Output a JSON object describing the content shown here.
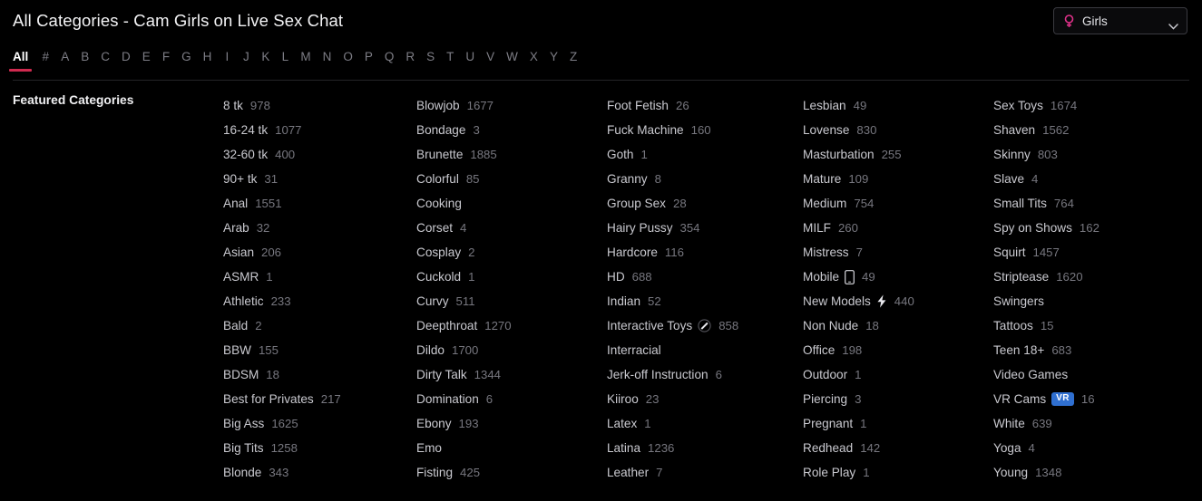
{
  "header": {
    "title": "All Categories - Cam Girls on Live Sex Chat",
    "gender_select": {
      "icon": "venus-icon",
      "value": "Girls",
      "chevron": "chevron-down-icon"
    }
  },
  "alphabet_filter": {
    "active": "All",
    "items": [
      "All",
      "#",
      "A",
      "B",
      "C",
      "D",
      "E",
      "F",
      "G",
      "H",
      "I",
      "J",
      "K",
      "L",
      "M",
      "N",
      "O",
      "P",
      "Q",
      "R",
      "S",
      "T",
      "U",
      "V",
      "W",
      "X",
      "Y",
      "Z"
    ]
  },
  "sidebar": {
    "featured_title": "Featured Categories"
  },
  "colors": {
    "accent": "#d02a4f",
    "venus": "#e0318a",
    "vr_badge": "#2f6fd0",
    "background": "#000000",
    "text_primary": "#c9c9cf",
    "text_muted": "#77777f"
  },
  "categories": {
    "columns": [
      [
        {
          "name": "8 tk",
          "count": "978"
        },
        {
          "name": "16-24 tk",
          "count": "1077"
        },
        {
          "name": "32-60 tk",
          "count": "400"
        },
        {
          "name": "90+ tk",
          "count": "31"
        },
        {
          "name": "Anal",
          "count": "1551"
        },
        {
          "name": "Arab",
          "count": "32"
        },
        {
          "name": "Asian",
          "count": "206"
        },
        {
          "name": "ASMR",
          "count": "1"
        },
        {
          "name": "Athletic",
          "count": "233"
        },
        {
          "name": "Bald",
          "count": "2"
        },
        {
          "name": "BBW",
          "count": "155"
        },
        {
          "name": "BDSM",
          "count": "18"
        },
        {
          "name": "Best for Privates",
          "count": "217"
        },
        {
          "name": "Big Ass",
          "count": "1625"
        },
        {
          "name": "Big Tits",
          "count": "1258"
        },
        {
          "name": "Blonde",
          "count": "343"
        }
      ],
      [
        {
          "name": "Blowjob",
          "count": "1677"
        },
        {
          "name": "Bondage",
          "count": "3"
        },
        {
          "name": "Brunette",
          "count": "1885"
        },
        {
          "name": "Colorful",
          "count": "85"
        },
        {
          "name": "Cooking",
          "count": ""
        },
        {
          "name": "Corset",
          "count": "4"
        },
        {
          "name": "Cosplay",
          "count": "2"
        },
        {
          "name": "Cuckold",
          "count": "1"
        },
        {
          "name": "Curvy",
          "count": "511"
        },
        {
          "name": "Deepthroat",
          "count": "1270"
        },
        {
          "name": "Dildo",
          "count": "1700"
        },
        {
          "name": "Dirty Talk",
          "count": "1344"
        },
        {
          "name": "Domination",
          "count": "6"
        },
        {
          "name": "Ebony",
          "count": "193"
        },
        {
          "name": "Emo",
          "count": ""
        },
        {
          "name": "Fisting",
          "count": "425"
        }
      ],
      [
        {
          "name": "Foot Fetish",
          "count": "26"
        },
        {
          "name": "Fuck Machine",
          "count": "160"
        },
        {
          "name": "Goth",
          "count": "1"
        },
        {
          "name": "Granny",
          "count": "8"
        },
        {
          "name": "Group Sex",
          "count": "28"
        },
        {
          "name": "Hairy Pussy",
          "count": "354"
        },
        {
          "name": "Hardcore",
          "count": "116"
        },
        {
          "name": "HD",
          "count": "688"
        },
        {
          "name": "Indian",
          "count": "52"
        },
        {
          "name": "Interactive Toys",
          "count": "858",
          "badge": "wand-icon"
        },
        {
          "name": "Interracial",
          "count": ""
        },
        {
          "name": "Jerk-off Instruction",
          "count": "6"
        },
        {
          "name": "Kiiroo",
          "count": "23"
        },
        {
          "name": "Latex",
          "count": "1"
        },
        {
          "name": "Latina",
          "count": "1236"
        },
        {
          "name": "Leather",
          "count": "7"
        }
      ],
      [
        {
          "name": "Lesbian",
          "count": "49"
        },
        {
          "name": "Lovense",
          "count": "830"
        },
        {
          "name": "Masturbation",
          "count": "255"
        },
        {
          "name": "Mature",
          "count": "109"
        },
        {
          "name": "Medium",
          "count": "754"
        },
        {
          "name": "MILF",
          "count": "260"
        },
        {
          "name": "Mistress",
          "count": "7"
        },
        {
          "name": "Mobile",
          "count": "49",
          "badge": "phone-icon"
        },
        {
          "name": "New Models",
          "count": "440",
          "badge": "bolt-icon"
        },
        {
          "name": "Non Nude",
          "count": "18"
        },
        {
          "name": "Office",
          "count": "198"
        },
        {
          "name": "Outdoor",
          "count": "1"
        },
        {
          "name": "Piercing",
          "count": "3"
        },
        {
          "name": "Pregnant",
          "count": "1"
        },
        {
          "name": "Redhead",
          "count": "142"
        },
        {
          "name": "Role Play",
          "count": "1"
        }
      ],
      [
        {
          "name": "Sex Toys",
          "count": "1674"
        },
        {
          "name": "Shaven",
          "count": "1562"
        },
        {
          "name": "Skinny",
          "count": "803"
        },
        {
          "name": "Slave",
          "count": "4"
        },
        {
          "name": "Small Tits",
          "count": "764"
        },
        {
          "name": "Spy on Shows",
          "count": "162"
        },
        {
          "name": "Squirt",
          "count": "1457"
        },
        {
          "name": "Striptease",
          "count": "1620"
        },
        {
          "name": "Swingers",
          "count": ""
        },
        {
          "name": "Tattoos",
          "count": "15"
        },
        {
          "name": "Teen 18+",
          "count": "683"
        },
        {
          "name": "Video Games",
          "count": ""
        },
        {
          "name": "VR Cams",
          "count": "16",
          "badge": "vr-badge"
        },
        {
          "name": "White",
          "count": "639"
        },
        {
          "name": "Yoga",
          "count": "4"
        },
        {
          "name": "Young",
          "count": "1348"
        }
      ]
    ]
  }
}
